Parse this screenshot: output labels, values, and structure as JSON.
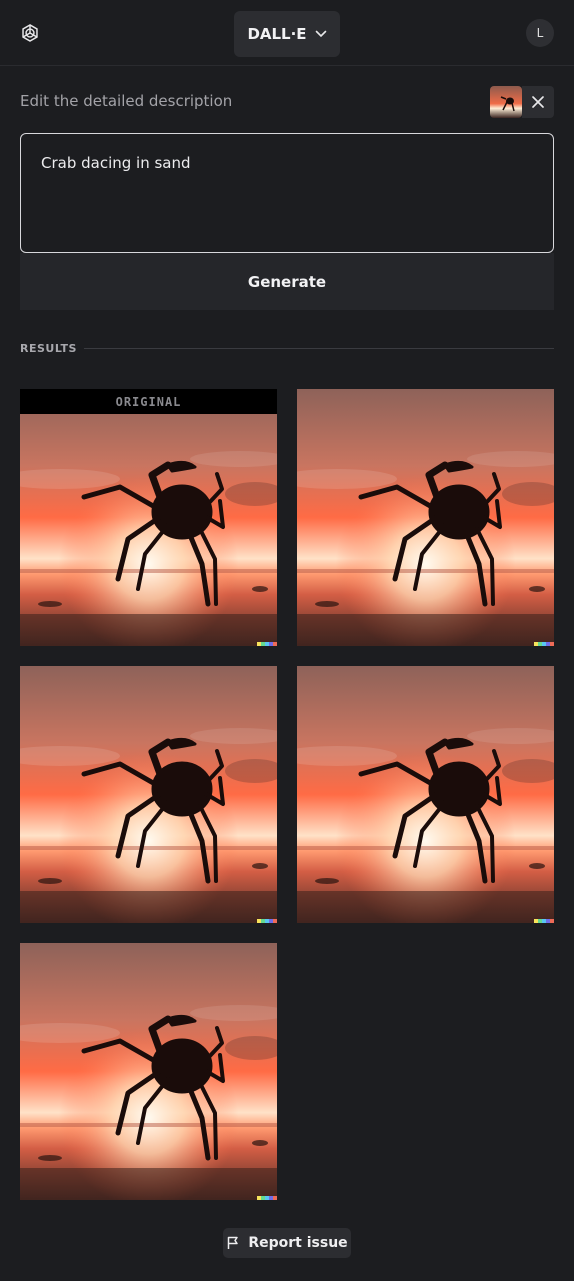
{
  "header": {
    "model_label": "DALL·E",
    "user_initial": "L",
    "logo_icon": "openai-logo-icon",
    "chevron_icon": "chevron-down-icon"
  },
  "editor": {
    "label": "Edit the detailed description",
    "prompt_value": "Crab dacing in sand",
    "close_icon": "close-icon",
    "generate_label": "Generate"
  },
  "results": {
    "section_label": "RESULTS",
    "original_label": "ORIGINAL",
    "image_count": 5
  },
  "footer": {
    "report_label": "Report issue",
    "report_icon": "flag-icon"
  },
  "colors": {
    "background": "#1c1d20",
    "sky_top": "#b86a55",
    "sun_glow": "#ff5a35",
    "signature": [
      "#f8e45c",
      "#66d98f",
      "#59c6f2",
      "#6f6de8",
      "#ee6b58"
    ]
  }
}
